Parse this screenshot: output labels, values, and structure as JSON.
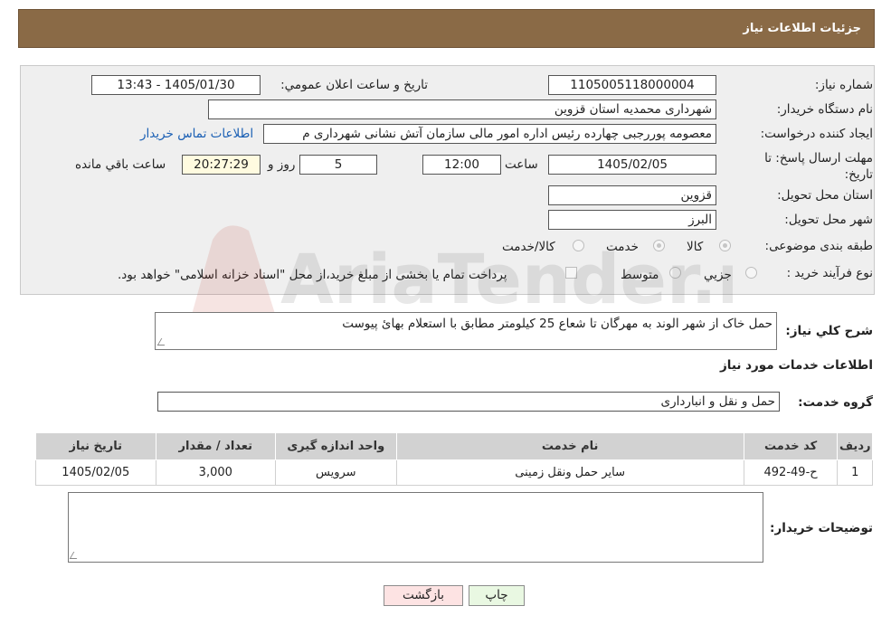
{
  "header": {
    "title": "جزئیات اطلاعات نیاز"
  },
  "labels": {
    "need_number": "شماره نیاز:",
    "announce_datetime": "تاریخ و ساعت اعلان عمومي:",
    "buyer_org": "نام دستگاه خریدار:",
    "requester": "ایجاد کننده درخواست:",
    "deadline": "مهلت ارسال پاسخ: تا تاریخ:",
    "time_word": "ساعت",
    "day_and": "روز و",
    "remaining": "ساعت باقي مانده",
    "province": "استان محل تحویل:",
    "city": "شهر محل تحویل:",
    "category": "طبقه بندی موضوعی:",
    "purchase_type": "نوع فرآیند خرید :",
    "description": "شرح کلي نیاز:",
    "services_info": "اطلاعات خدمات مورد نیاز",
    "service_group": "گروه خدمت:",
    "buyer_notes": "توضیحات خریدار:"
  },
  "values": {
    "need_number": "1105005118000004",
    "announce_datetime": "1405/01/30 - 13:43",
    "buyer_org": "شهرداری محمدیه استان قزوین",
    "requester": "معصومه پوررجبی چهارده رئیس اداره امور مالی سازمان آتش نشانی شهرداری م",
    "contact_link": "اطلاعات تماس خریدار",
    "deadline_date": "1405/02/05",
    "deadline_time": "12:00",
    "days": "5",
    "remaining_time": "20:27:29",
    "province": "قزوین",
    "city": "البرز",
    "description": "حمل خاک از شهر الوند به مهرگان تا شعاع 25 کیلومتر مطابق با استعلام بهائ پیوست",
    "service_group": "حمل و نقل و انبارداری",
    "buyer_notes": ""
  },
  "category_options": [
    {
      "label": "کالا",
      "selected": true
    },
    {
      "label": "خدمت",
      "selected": true
    },
    {
      "label": "کالا/خدمت",
      "selected": false
    }
  ],
  "purchase_options": [
    {
      "label": "جزيي",
      "selected": false
    },
    {
      "label": "متوسط",
      "selected": false
    }
  ],
  "purchase_note": "پرداخت تمام یا بخشی از مبلغ خرید،از محل \"اسناد خزانه اسلامی\" خواهد بود.",
  "table": {
    "headers": [
      "رديف",
      "کد خدمت",
      "نام خدمت",
      "واحد اندازه گیری",
      "تعداد / مقدار",
      "تاریخ نیاز"
    ],
    "rows": [
      [
        "1",
        "ح-49-492",
        "سایر حمل ونقل زمینی",
        "سرویس",
        "3,000",
        "1405/02/05"
      ]
    ]
  },
  "buttons": {
    "print": "چاپ",
    "back": "بازگشت"
  },
  "watermark": "AriaTender.neT",
  "colors": {
    "header_bg": "#8a6a46",
    "panel_bg": "#efefef",
    "link": "#1a5fb4",
    "back_btn": "#fde3e3",
    "print_btn": "#e9f8e2"
  }
}
